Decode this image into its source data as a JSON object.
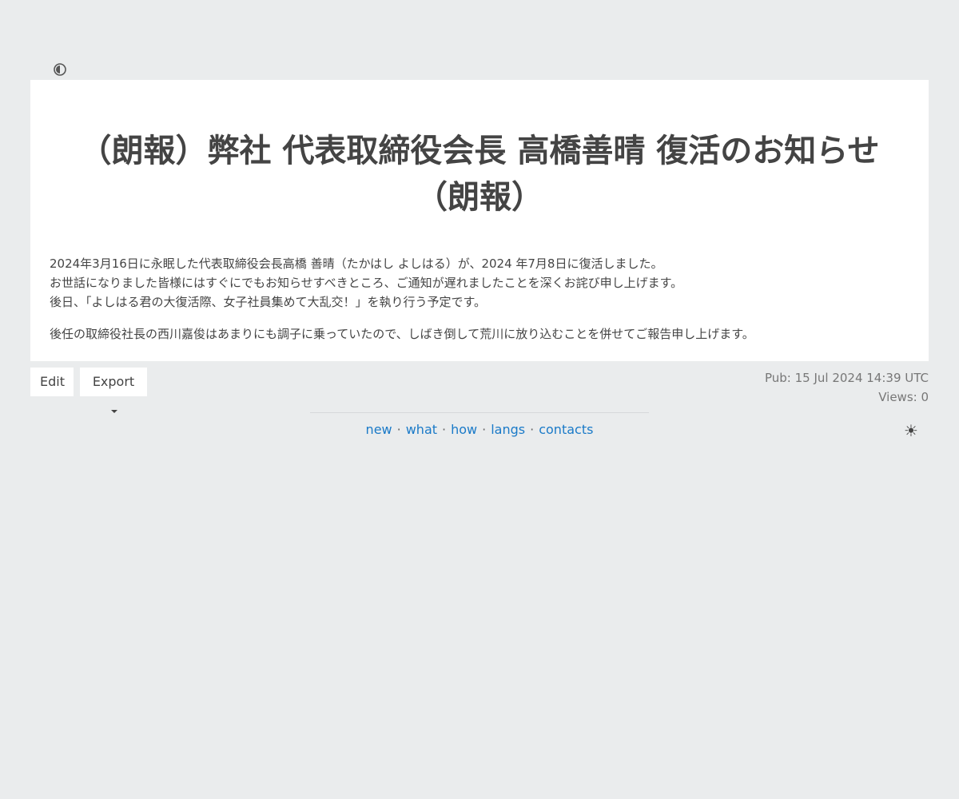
{
  "page": {
    "contrast_icon": "contrast-icon",
    "theme_icon": "sun-icon",
    "theme_glyph": "☀"
  },
  "article": {
    "title": "（朗報）弊社 代表取締役会長 高橋善晴 復活のお知らせ（朗報）",
    "lines": [
      "2024年3月16日に永眠した代表取締役会長高橋 善晴（たかはし よしはる）が、2024 年7月8日に復活しました。",
      "お世話になりました皆様にはすぐにでもお知らせすべきところ、ご通知が遅れましたことを深くお詫び申し上げます。",
      "後日、「よしはる君の大復活際、女子社員集めて大乱交！」を執り行う予定です。"
    ],
    "paragraph2": "後任の取締役社長の西川嘉俊はあまりにも調子に乗っていたので、しばき倒して荒川に放り込むことを併せてご報告申し上げます。"
  },
  "actions": {
    "edit_label": "Edit",
    "export_label": "Export"
  },
  "meta": {
    "published": "Pub: 15 Jul 2024 14:39 UTC",
    "views": "Views: 0"
  },
  "footer": {
    "links": [
      "new",
      "what",
      "how",
      "langs",
      "contacts"
    ],
    "separator": "·"
  },
  "colors": {
    "background": "#eaeced",
    "card": "#ffffff",
    "text": "#444444",
    "muted": "#777777",
    "link": "#1a7ac8"
  }
}
